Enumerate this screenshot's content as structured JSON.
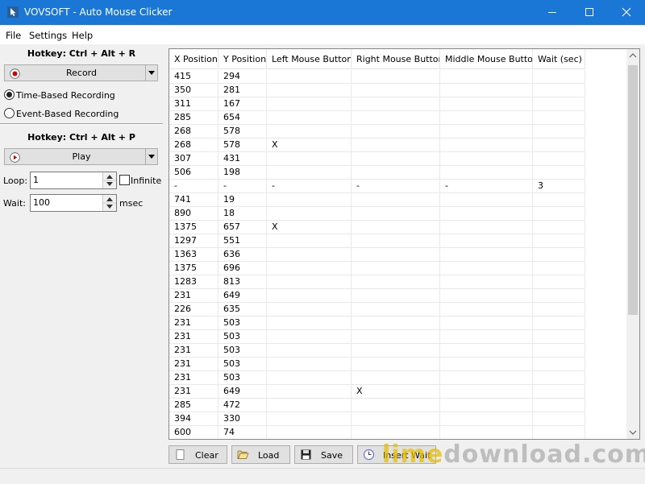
{
  "window": {
    "title": "VOVSOFT - Auto Mouse Clicker"
  },
  "menu": {
    "file": "File",
    "settings": "Settings",
    "help": "Help"
  },
  "left": {
    "record_hotkey": "Hotkey: Ctrl + Alt + R",
    "record_label": "Record",
    "time_based": "Time-Based Recording",
    "event_based": "Event-Based Recording",
    "play_hotkey": "Hotkey: Ctrl + Alt + P",
    "play_label": "Play",
    "loop_label": "Loop:",
    "loop_value": "1",
    "infinite_label": "Infinite",
    "wait_label": "Wait:",
    "wait_value": "100",
    "wait_unit": "msec"
  },
  "grid": {
    "columns": [
      "X Position",
      "Y Position",
      "Left Mouse Button",
      "Right Mouse Button",
      "Middle Mouse Button",
      "Wait (sec)"
    ],
    "rows": [
      [
        "415",
        "294",
        "",
        "",
        "",
        ""
      ],
      [
        "350",
        "281",
        "",
        "",
        "",
        ""
      ],
      [
        "311",
        "167",
        "",
        "",
        "",
        ""
      ],
      [
        "285",
        "654",
        "",
        "",
        "",
        ""
      ],
      [
        "268",
        "578",
        "",
        "",
        "",
        ""
      ],
      [
        "268",
        "578",
        "X",
        "",
        "",
        ""
      ],
      [
        "307",
        "431",
        "",
        "",
        "",
        ""
      ],
      [
        "506",
        "198",
        "",
        "",
        "",
        ""
      ],
      [
        "-",
        "-",
        "-",
        "-",
        "-",
        "3"
      ],
      [
        "741",
        "19",
        "",
        "",
        "",
        ""
      ],
      [
        "890",
        "18",
        "",
        "",
        "",
        ""
      ],
      [
        "1375",
        "657",
        "X",
        "",
        "",
        ""
      ],
      [
        "1297",
        "551",
        "",
        "",
        "",
        ""
      ],
      [
        "1363",
        "636",
        "",
        "",
        "",
        ""
      ],
      [
        "1375",
        "696",
        "",
        "",
        "",
        ""
      ],
      [
        "1283",
        "813",
        "",
        "",
        "",
        ""
      ],
      [
        "231",
        "649",
        "",
        "",
        "",
        ""
      ],
      [
        "226",
        "635",
        "",
        "",
        "",
        ""
      ],
      [
        "231",
        "503",
        "",
        "",
        "",
        ""
      ],
      [
        "231",
        "503",
        "",
        "",
        "",
        ""
      ],
      [
        "231",
        "503",
        "",
        "",
        "",
        ""
      ],
      [
        "231",
        "503",
        "",
        "",
        "",
        ""
      ],
      [
        "231",
        "503",
        "",
        "",
        "",
        ""
      ],
      [
        "231",
        "649",
        "",
        "X",
        "",
        ""
      ],
      [
        "285",
        "472",
        "",
        "",
        "",
        ""
      ],
      [
        "394",
        "330",
        "",
        "",
        "",
        ""
      ],
      [
        "600",
        "74",
        "",
        "",
        "",
        ""
      ]
    ]
  },
  "buttons": {
    "clear": "Clear",
    "load": "Load",
    "save": "Save",
    "insert_wait": "Insert Wait"
  },
  "watermark": {
    "part1": "lime",
    "part2": "download.com"
  },
  "colors": {
    "titlebar": "#1b77d6",
    "record_dot": "#cc0000"
  }
}
